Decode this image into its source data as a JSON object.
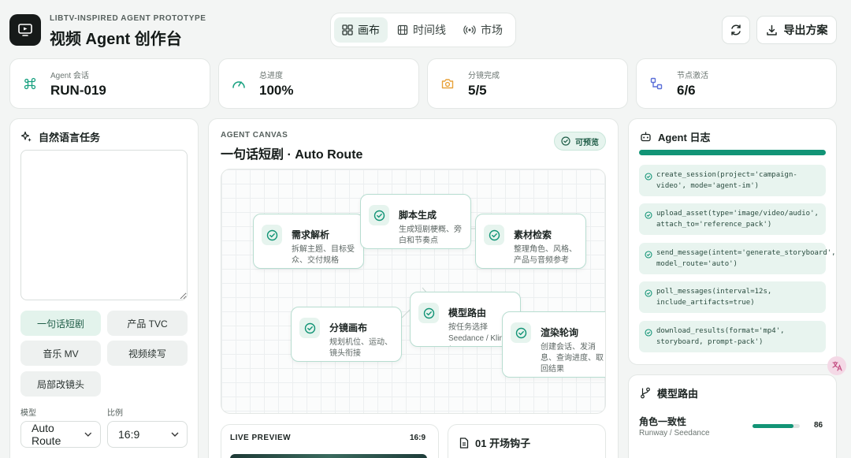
{
  "header": {
    "subtitle": "LIBTV-INSPIRED AGENT PROTOTYPE",
    "title": "视频 Agent 创作台",
    "tabs": [
      {
        "label": "画布",
        "icon": "grid-icon",
        "active": true
      },
      {
        "label": "时间线",
        "icon": "film-icon",
        "active": false
      },
      {
        "label": "市场",
        "icon": "broadcast-icon",
        "active": false
      }
    ],
    "refresh_icon": "refresh-icon",
    "export_label": "导出方案"
  },
  "stats": [
    {
      "label": "Agent 会话",
      "value": "RUN-019",
      "icon": "command-icon",
      "color": "#16a07f"
    },
    {
      "label": "总进度",
      "value": "100%",
      "icon": "gauge-icon",
      "color": "#16a07f"
    },
    {
      "label": "分镜完成",
      "value": "5/5",
      "icon": "camera-icon",
      "color": "#e8a23a"
    },
    {
      "label": "节点激活",
      "value": "6/6",
      "icon": "workflow-icon",
      "color": "#5a6fd8"
    }
  ],
  "task_panel": {
    "title": "自然语言任务",
    "textarea_value": "",
    "chips": [
      {
        "label": "一句话短剧",
        "active": true
      },
      {
        "label": "产品 TVC",
        "active": false
      },
      {
        "label": "音乐 MV",
        "active": false
      },
      {
        "label": "视频续写",
        "active": false
      },
      {
        "label": "局部改镜头",
        "active": false
      }
    ],
    "model_label": "模型",
    "model_value": "Auto Route",
    "ratio_label": "比例",
    "ratio_value": "16:9"
  },
  "canvas": {
    "eyebrow": "AGENT CANVAS",
    "title": "一句话短剧 · Auto Route",
    "badge": "可预览",
    "nodes": [
      {
        "title": "需求解析",
        "desc": "拆解主题、目标受众、交付规格"
      },
      {
        "title": "脚本生成",
        "desc": "生成短剧梗概、旁白和节奏点"
      },
      {
        "title": "素材检索",
        "desc": "整理角色、风格、产品与音频参考"
      },
      {
        "title": "分镜画布",
        "desc": "规划机位、运动、镜头衔接"
      },
      {
        "title": "模型路由",
        "desc": "按任务选择 Seedance / Kling / Wan"
      },
      {
        "title": "渲染轮询",
        "desc": "创建会话、发消息、查询进度、取回结果"
      }
    ],
    "live_preview_label": "LIVE PREVIEW",
    "live_preview_ratio": "16:9",
    "shot_title": "01 开场钩子"
  },
  "log_panel": {
    "title": "Agent 日志",
    "entries": [
      "create_session(project='campaign-video', mode='agent-im')",
      "upload_asset(type='image/video/audio', attach_to='reference_pack')",
      "send_message(intent='generate_storyboard', model_route='auto')",
      "poll_messages(interval=12s, include_artifacts=true)",
      "download_results(format='mp4', storyboard, prompt-pack')"
    ]
  },
  "routing_panel": {
    "title": "模型路由",
    "items": [
      {
        "name": "角色一致性",
        "models": "Runway / Seedance",
        "score": 86
      }
    ]
  },
  "colors": {
    "accent": "#129476",
    "accent_soft": "#e6f4ee",
    "node_border": "#b7ddd0"
  }
}
